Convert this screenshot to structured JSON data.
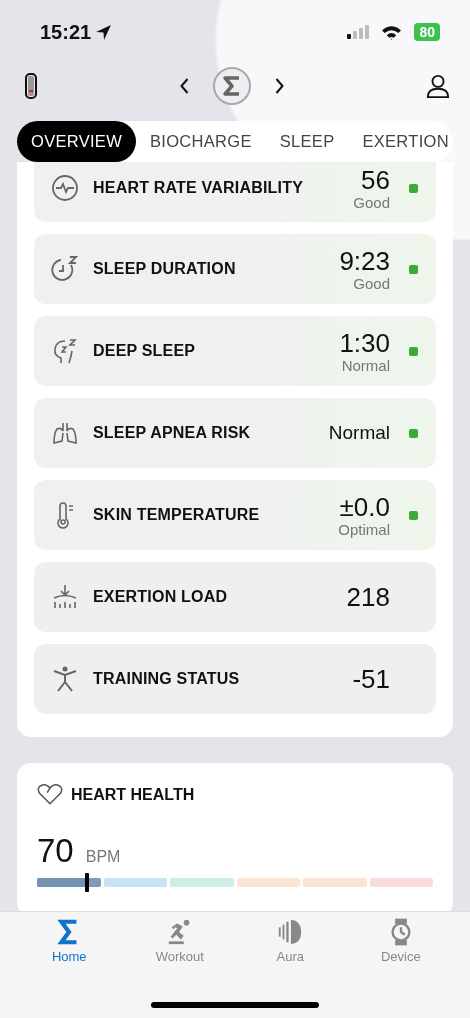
{
  "status_bar": {
    "time": "15:21",
    "battery": "80"
  },
  "tabs": [
    {
      "label": "OVERVIEW",
      "selected": true
    },
    {
      "label": "BIOCHARGE",
      "selected": false
    },
    {
      "label": "SLEEP",
      "selected": false
    },
    {
      "label": "EXERTION",
      "selected": false
    }
  ],
  "metrics": [
    {
      "kind": "hrv",
      "name": "HEART RATE VARIABILITY",
      "value": "56",
      "rating": "Good",
      "color": "#3aab36"
    },
    {
      "kind": "sleep",
      "name": "SLEEP DURATION",
      "value": "9:23",
      "rating": "Good",
      "color": "#3aab36"
    },
    {
      "kind": "deep",
      "name": "DEEP SLEEP",
      "value": "1:30",
      "rating": "Normal",
      "color": "#3aab36"
    },
    {
      "kind": "apnea",
      "name": "SLEEP APNEA RISK",
      "value": "Normal",
      "color": "#3aab36"
    },
    {
      "kind": "temp",
      "name": "SKIN TEMPERATURE",
      "value": "±0.0",
      "rating": "Optimal",
      "color": "#3aab36"
    },
    {
      "kind": "load",
      "name": "EXERTION LOAD",
      "value": "218"
    },
    {
      "kind": "training",
      "name": "TRAINING STATUS",
      "value": "-51"
    }
  ],
  "heart_health": {
    "title": "HEART HEALTH",
    "value": "70",
    "unit": "BPM",
    "level": 0.126,
    "zones": [
      {
        "color": "#c9e3f6"
      },
      {
        "color": "#cdeee2"
      },
      {
        "color": "#fbe6d3"
      },
      {
        "color": "#fbe2d6"
      },
      {
        "color": "#fbdcdc"
      }
    ]
  },
  "nav": [
    {
      "kind": "home",
      "label": "Home",
      "selected": true
    },
    {
      "kind": "workout",
      "label": "Workout",
      "selected": false
    },
    {
      "kind": "aura",
      "label": "Aura",
      "selected": false
    },
    {
      "kind": "device",
      "label": "Device",
      "selected": false
    }
  ]
}
